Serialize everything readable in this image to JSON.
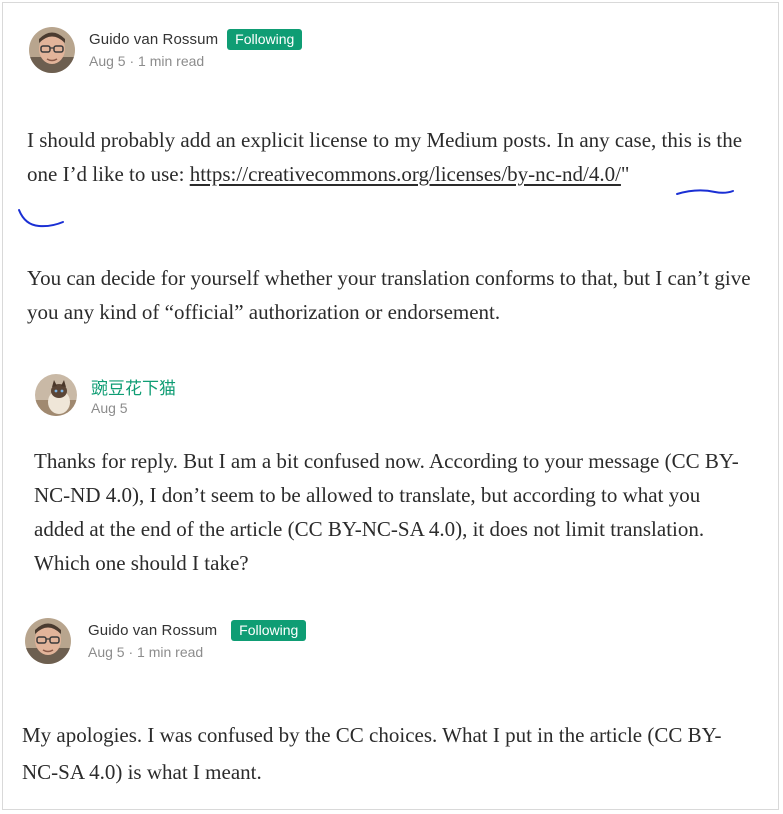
{
  "post": {
    "author": "Guido van Rossum",
    "follow_label": "Following",
    "date": "Aug 5",
    "read_time": "1 min read",
    "para1_text": "I should probably add an explicit license to my Medium posts. In any case, this is the one I’d like to use: ",
    "para1_link": "https://creativecommons.org/licenses/by-nc-nd/4.0/",
    "para1_after": "\"",
    "para2": "You can decide for yourself whether your translation conforms to that, but I can’t give you any kind of “official” authorization or endorsement."
  },
  "reply": {
    "author": "豌豆花下猫",
    "date": "Aug 5",
    "text": "Thanks for reply. But I am a bit confused now. According to your message (CC BY-NC-ND 4.0), I don’t seem to be allowed to translate, but according to what you added at the end of the article (CC BY-NC-SA 4.0), it does not limit translation. Which one should I take?"
  },
  "response": {
    "author": "Guido van Rossum",
    "follow_label": "Following",
    "date": "Aug 5",
    "read_time": "1 min read",
    "text": "My apologies. I was confused by the CC choices. What I put in the article (CC BY-NC-SA 4.0) is what I meant."
  },
  "meta_separator": " · ",
  "colors": {
    "accent_green": "#0f9d74",
    "muted_text": "#8c8c8c",
    "body_text": "#2b2b2b",
    "annotation_ink": "#1a2fd4"
  },
  "icons": {
    "author_avatar": "person-portrait-icon",
    "reply_avatar": "cat-photo-icon",
    "annotation": "handwritten-underline-marks"
  }
}
